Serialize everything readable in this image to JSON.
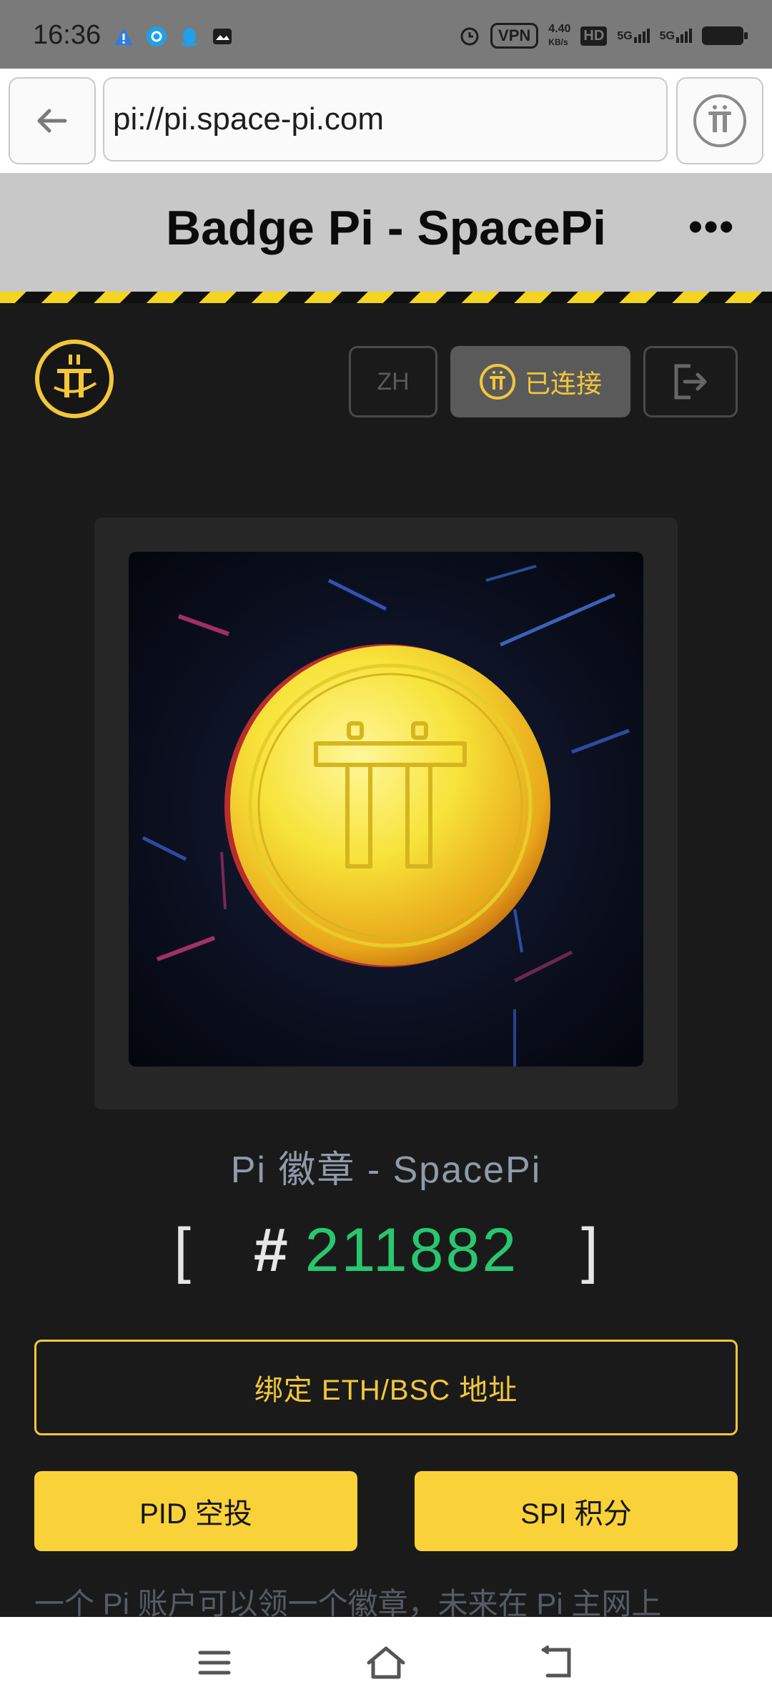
{
  "status_bar": {
    "time": "16:36",
    "vpn": "VPN",
    "net_speed_value": "4.40",
    "net_speed_unit": "KB/s",
    "hd": "HD",
    "signal1": "5G",
    "signal2": "5G"
  },
  "browser": {
    "url": "pi://pi.space-pi.com",
    "back_icon": "arrow-left-icon",
    "pi_icon": "pi-logo-icon"
  },
  "header": {
    "title": "Badge Pi - SpacePi",
    "more_label": "•••"
  },
  "topbar": {
    "lang_label": "ZH",
    "connected_label": "已连接",
    "logout_icon": "logout-icon"
  },
  "badge": {
    "name": "Pi 徽章 - SpacePi",
    "hash": "#",
    "number": "211882",
    "bracket_open": "[",
    "bracket_close": "]"
  },
  "actions": {
    "bind_label": "绑定 ETH/BSC 地址",
    "pid_label": "PID 空投",
    "spi_label": "SPI 积分"
  },
  "description": "一个 Pi 账户可以领一个徽章，未来在 Pi 主网上",
  "colors": {
    "accent": "#f2c73a",
    "number_green": "#28c76f",
    "background": "#1a1a1a"
  },
  "nav": {
    "menu_icon": "menu-icon",
    "home_icon": "home-icon",
    "back_icon": "back-icon"
  }
}
